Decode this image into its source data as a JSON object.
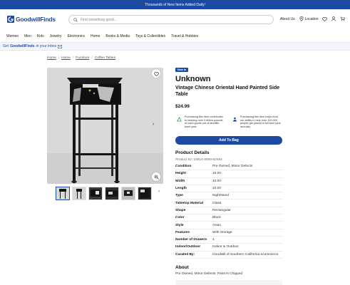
{
  "promo": {
    "text": "Thousands of New Items Added Daily!"
  },
  "header": {
    "logo_text": "GoodwillFinds",
    "search_placeholder": "Find something good...",
    "about_us": "About Us",
    "location": "Location"
  },
  "nav": {
    "items": [
      "Women",
      "Men",
      "Kids",
      "Jewelry",
      "Electronics",
      "Home",
      "Books & Media",
      "Toys & Collectibles",
      "Travel & Hobbies"
    ]
  },
  "inbox": {
    "prefix": "Get",
    "brand": "GoodwillFinds",
    "suffix": "in your Inbox"
  },
  "breadcrumb": [
    "Home",
    "Home",
    "Furniture",
    "Coffee Tables"
  ],
  "product": {
    "badge": "New In",
    "brand": "Unknown",
    "title": "Vintage Chinese Oriental Hand Painted Side Table",
    "price": "$24.99",
    "impact_1": "Purchasing this item contributes to keeping over 3 billion pounds of used goods out of landfills each year.",
    "impact_2": "Purchasing this item helps fund our ability to help over 100,000 people get placed in full-time jobs annually.",
    "add_to_bag": "Add To Bag"
  },
  "details": {
    "title": "Product Details",
    "product_id": "Product ID: 10014-0000-62482",
    "specs": [
      {
        "k": "Condition",
        "v": "Pre Owned, Minor Defects"
      },
      {
        "k": "Height",
        "v": "16.00"
      },
      {
        "k": "Width",
        "v": "10.00"
      },
      {
        "k": "Length",
        "v": "10.00"
      },
      {
        "k": "Type",
        "v": "Nightstand"
      },
      {
        "k": "Tabletop Material",
        "v": "Glass"
      },
      {
        "k": "Shape",
        "v": "Rectangular"
      },
      {
        "k": "Color",
        "v": "Black"
      },
      {
        "k": "Style",
        "v": "Asian"
      },
      {
        "k": "Features",
        "v": "With Storage"
      },
      {
        "k": "Number of Drawers",
        "v": "1"
      },
      {
        "k": "Indoor/Outdoor",
        "v": "Indoor & Outdoor"
      },
      {
        "k": "Curated By:",
        "v": "Goodwill of Southern California ecommerce"
      }
    ]
  },
  "about": {
    "title": "About",
    "text": "Pre Owned, Minor Defects. Paint Is Chipped"
  },
  "colors": {
    "brand_blue": "#1c4aa3",
    "impact_green": "#3a9a4a"
  },
  "icons": [
    "search-icon",
    "location-pin-icon",
    "heart-icon",
    "user-icon",
    "cart-icon",
    "mail-icon",
    "zoom-icon",
    "chevron-right-icon"
  ]
}
